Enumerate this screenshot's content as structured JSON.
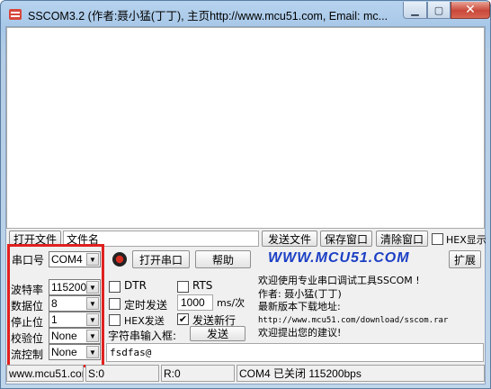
{
  "window": {
    "title": "SSCOM3.2 (作者:聂小猛(丁丁), 主页http://www.mcu51.com,  Email: mc..."
  },
  "toolbar": {
    "open_file": "打开文件",
    "file_name": "文件名",
    "send_file": "发送文件",
    "save_window": "保存窗口",
    "clear_window": "清除窗口",
    "hex_display": "HEX显示"
  },
  "port": {
    "port_label": "串口号",
    "port_value": "COM4",
    "open_port": "打开串口",
    "help": "帮助",
    "logo": "WWW.MCU51.COM",
    "expand": "扩展"
  },
  "settings": [
    {
      "label": "波特率",
      "value": "115200"
    },
    {
      "label": "数据位",
      "value": "8"
    },
    {
      "label": "停止位",
      "value": "1"
    },
    {
      "label": "校验位",
      "value": "None"
    },
    {
      "label": "流控制",
      "value": "None"
    }
  ],
  "options": {
    "dtr": "DTR",
    "rts": "RTS",
    "timed_send": "定时发送",
    "interval": "1000",
    "interval_unit": "ms/次",
    "hex_send": "HEX发送",
    "send_newline": "发送新行",
    "input_label": "字符串输入框:",
    "send": "发送",
    "input_value": "fsdfas@"
  },
  "info": [
    "欢迎使用专业串口调试工具SSCOM !",
    "作者: 聂小猛(丁丁)",
    "最新版本下载地址:",
    "http://www.mcu51.com/download/sscom.rar",
    "欢迎提出您的建议!"
  ],
  "status": {
    "site": "www.mcu51.cor",
    "sent": "S:0",
    "received": "R:0",
    "port_state": "COM4 已关闭  115200bps"
  },
  "colors": {
    "highlight_box": "#e0201e",
    "logo": "#1b3fc4",
    "titlebar": "#b7d3ee"
  }
}
